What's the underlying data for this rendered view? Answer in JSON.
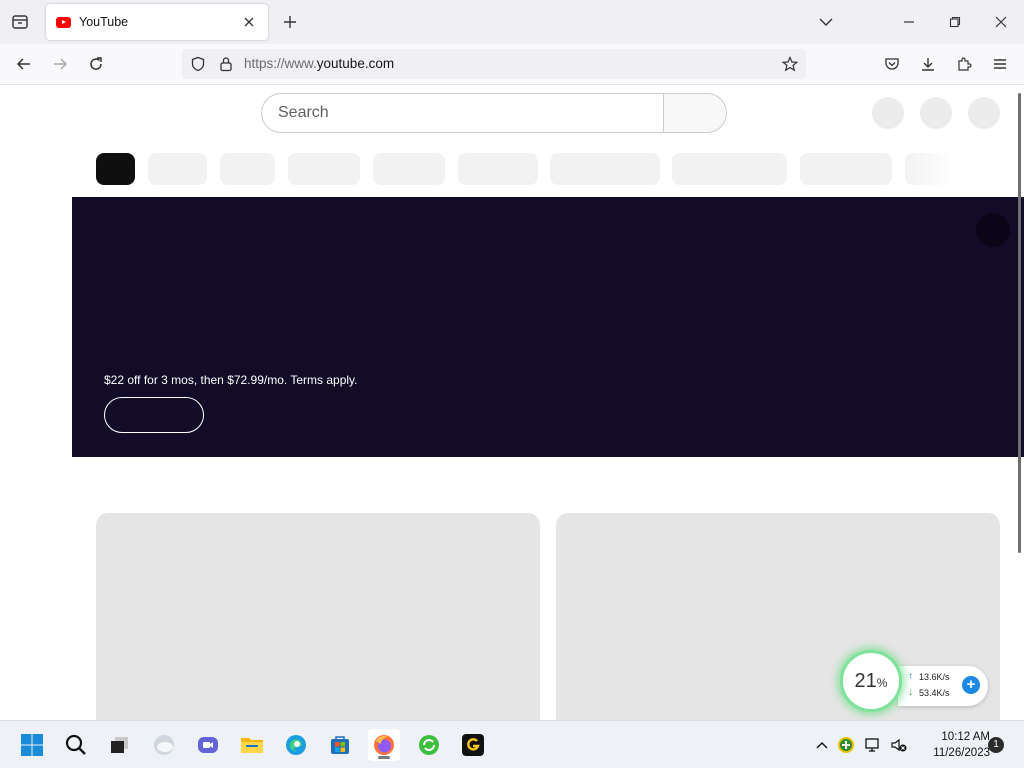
{
  "browser": {
    "tab": {
      "title": "YouTube"
    },
    "url": {
      "prefix": "https://www.",
      "domain": "youtube.com"
    }
  },
  "youtube": {
    "search": {
      "placeholder": "Search"
    },
    "banner": {
      "offer_text": "$22 off for 3 mos, then $72.99/mo. Terms apply."
    }
  },
  "network_widget": {
    "percent": "21",
    "percent_unit": "%",
    "upload": "13.6K/s",
    "download": "53.4K/s"
  },
  "taskbar": {
    "time": "10:12 AM",
    "date": "11/26/2023",
    "notification_count": "1"
  },
  "colors": {
    "banner_bg": "#120c28",
    "youtube_red": "#ff0000",
    "ring_green": "#7ee29a",
    "accent_blue": "#1e88e5"
  }
}
